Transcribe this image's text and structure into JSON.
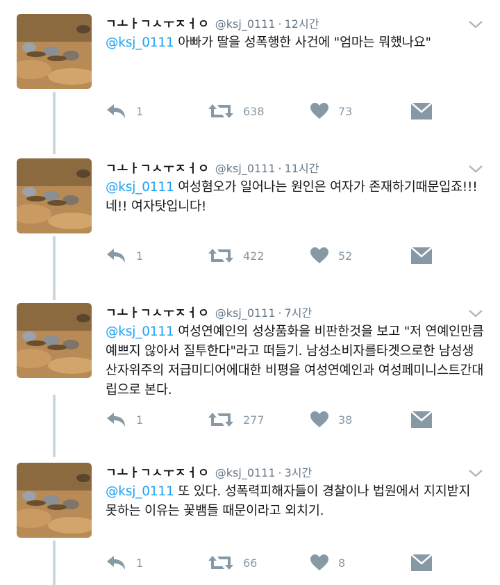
{
  "tweets": [
    {
      "name": "ㄱㅗㅏㄱㅅㅜㅈㅓㅇ",
      "handle": "@ksj_0111",
      "dot": "·",
      "time": "12시간",
      "mention": "@ksj_0111",
      "text": " 아빠가 딸을 성폭행한 사건에 \"엄마는 뭐했나요\"",
      "reply_count": "1",
      "retweet_count": "638",
      "like_count": "73"
    },
    {
      "name": "ㄱㅗㅏㄱㅅㅜㅈㅓㅇ",
      "handle": "@ksj_0111",
      "dot": "·",
      "time": "11시간",
      "mention": "@ksj_0111",
      "text": " 여성혐오가 일어나는 원인은 여자가 존재하기때문입죠!!! 네!! 여자탓입니다!",
      "reply_count": "1",
      "retweet_count": "422",
      "like_count": "52"
    },
    {
      "name": "ㄱㅗㅏㄱㅅㅜㅈㅓㅇ",
      "handle": "@ksj_0111",
      "dot": "·",
      "time": "7시간",
      "mention": "@ksj_0111",
      "text": " 여성연예인의 성상품화을 비판한것을 보고 \"저 연예인만큼 예쁘지 않아서 질투한다\"라고 떠들기. 남성소비자를타겟으로한 남성생산자위주의 저급미디어에대한 비평을 여성연예인과 여성페미니스트간대립으로 본다.",
      "reply_count": "1",
      "retweet_count": "277",
      "like_count": "38"
    },
    {
      "name": "ㄱㅗㅏㄱㅅㅜㅈㅓㅇ",
      "handle": "@ksj_0111",
      "dot": "·",
      "time": "3시간",
      "mention": "@ksj_0111",
      "text": " 또 있다. 성폭력피해자들이 경찰이나 법원에서 지지받지 못하는 이유는 꽃뱀들 때문이라고 외치기.",
      "reply_count": "1",
      "retweet_count": "66",
      "like_count": "8"
    }
  ],
  "icons": {
    "reply": "reply-icon",
    "retweet": "retweet-icon",
    "like": "heart-icon",
    "message": "direct-message-icon",
    "more": "chevron-down-icon"
  },
  "colors": {
    "mention": "#1da1f2",
    "secondary_text": "#657786",
    "icon": "#8899a6",
    "thread_line": "#ccd6dd"
  }
}
